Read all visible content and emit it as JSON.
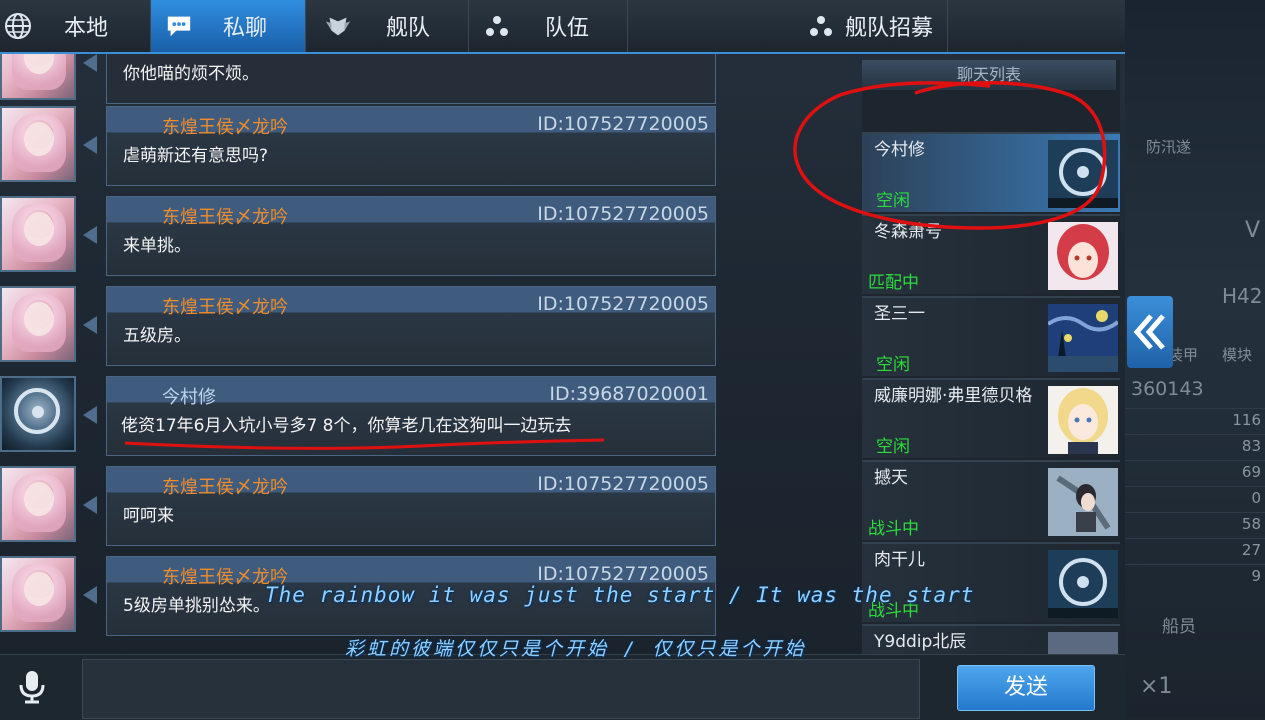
{
  "tabs": [
    {
      "label": "本地",
      "icon": "globe-icon"
    },
    {
      "label": "私聊",
      "icon": "chat-bubble-icon"
    },
    {
      "label": "舰队",
      "icon": "fleet-emblem-icon"
    },
    {
      "label": "队伍",
      "icon": "team-dots-icon"
    },
    {
      "label": "舰队招募",
      "icon": "recruit-dots-icon"
    }
  ],
  "messages": [
    {
      "name": "",
      "id": "",
      "text": "你他喵的烦不烦。",
      "avatar": "anime-girl-avatar"
    },
    {
      "name": "东煌王侯〆龙吟",
      "id": "ID:107527720005",
      "text": "虐萌新还有意思吗?",
      "avatar": "anime-girl-avatar"
    },
    {
      "name": "东煌王侯〆龙吟",
      "id": "ID:107527720005",
      "text": "来单挑。",
      "avatar": "anime-girl-avatar"
    },
    {
      "name": "东煌王侯〆龙吟",
      "id": "ID:107527720005",
      "text": "五级房。",
      "avatar": "anime-girl-avatar"
    },
    {
      "name": "今村修",
      "id": "ID:39687020001",
      "text": "佬资17年6月入坑小号多7 8个，你算老几在这狗叫一边玩去",
      "avatar": "ship-wheel-avatar"
    },
    {
      "name": "东煌王侯〆龙吟",
      "id": "ID:107527720005",
      "text": "呵呵来",
      "avatar": "anime-girl-avatar"
    },
    {
      "name": "东煌王侯〆龙吟",
      "id": "ID:107527720005",
      "text": "5级房单挑别怂来。",
      "avatar": "anime-girl-avatar"
    }
  ],
  "chat_list": {
    "title": "聊天列表",
    "items": [
      {
        "name": "今村修",
        "status": "空闲"
      },
      {
        "name": "冬森萧号",
        "status": "匹配中"
      },
      {
        "name": "圣三一",
        "status": "空闲"
      },
      {
        "name": "威廉明娜·弗里德贝格",
        "status": "空闲"
      },
      {
        "name": "撼天",
        "status": "战斗中"
      },
      {
        "name": "肉干儿",
        "status": "战斗中"
      },
      {
        "name": "Y9ddip北辰",
        "status": ""
      }
    ]
  },
  "right_panel": {
    "labels": [
      "防汛遂",
      "V",
      "H42",
      "装甲",
      "模块",
      "360143",
      "船员",
      "×1"
    ],
    "numbers": [
      "116",
      "83",
      "69",
      "0",
      "58",
      "27",
      "9"
    ]
  },
  "send_label": "发送",
  "subtitles": {
    "line1": "The rainbow it was just the start / It was the start",
    "line2": "彩虹的彼端仅仅只是个开始 / 仅仅只是个开始"
  },
  "colors": {
    "accent": "#2f8ee0",
    "name_orange": "#f08d2a",
    "status_green": "#2bdc3a",
    "annotation_red": "#e01010"
  }
}
